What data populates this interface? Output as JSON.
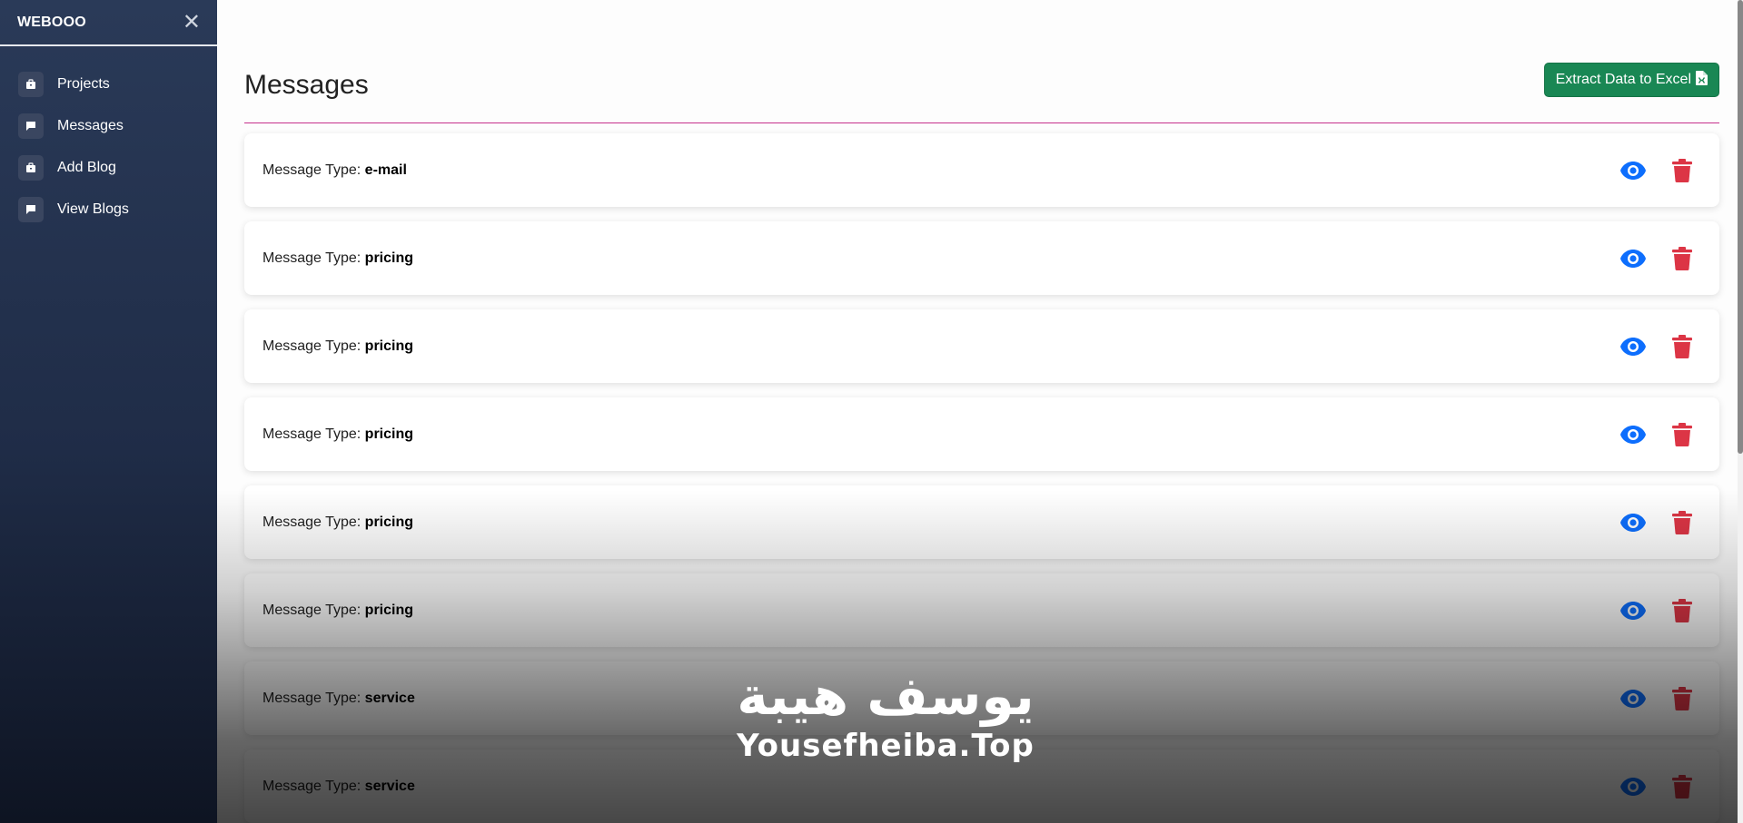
{
  "sidebar": {
    "brand": "WEBOOO",
    "close_icon": "close-icon",
    "items": [
      {
        "label": "Projects",
        "icon": "briefcase-icon"
      },
      {
        "label": "Messages",
        "icon": "chat-icon"
      },
      {
        "label": "Add Blog",
        "icon": "briefcase-icon"
      },
      {
        "label": "View Blogs",
        "icon": "chat-icon"
      }
    ]
  },
  "main": {
    "title": "Messages",
    "excel_button": "Extract Data to Excel",
    "divider_color": "#c7318c",
    "messages": [
      {
        "label": "Message Type:",
        "type": "e-mail"
      },
      {
        "label": "Message Type:",
        "type": "pricing"
      },
      {
        "label": "Message Type:",
        "type": "pricing"
      },
      {
        "label": "Message Type:",
        "type": "pricing"
      },
      {
        "label": "Message Type:",
        "type": "pricing"
      },
      {
        "label": "Message Type:",
        "type": "pricing"
      },
      {
        "label": "Message Type:",
        "type": "service"
      },
      {
        "label": "Message Type:",
        "type": "service"
      }
    ]
  },
  "watermark": {
    "arabic": "يوسف هيبة",
    "latin": "Yousefheiba.Top"
  },
  "colors": {
    "view": "#0d6efd",
    "delete": "#dc3545",
    "excel": "#198754"
  }
}
